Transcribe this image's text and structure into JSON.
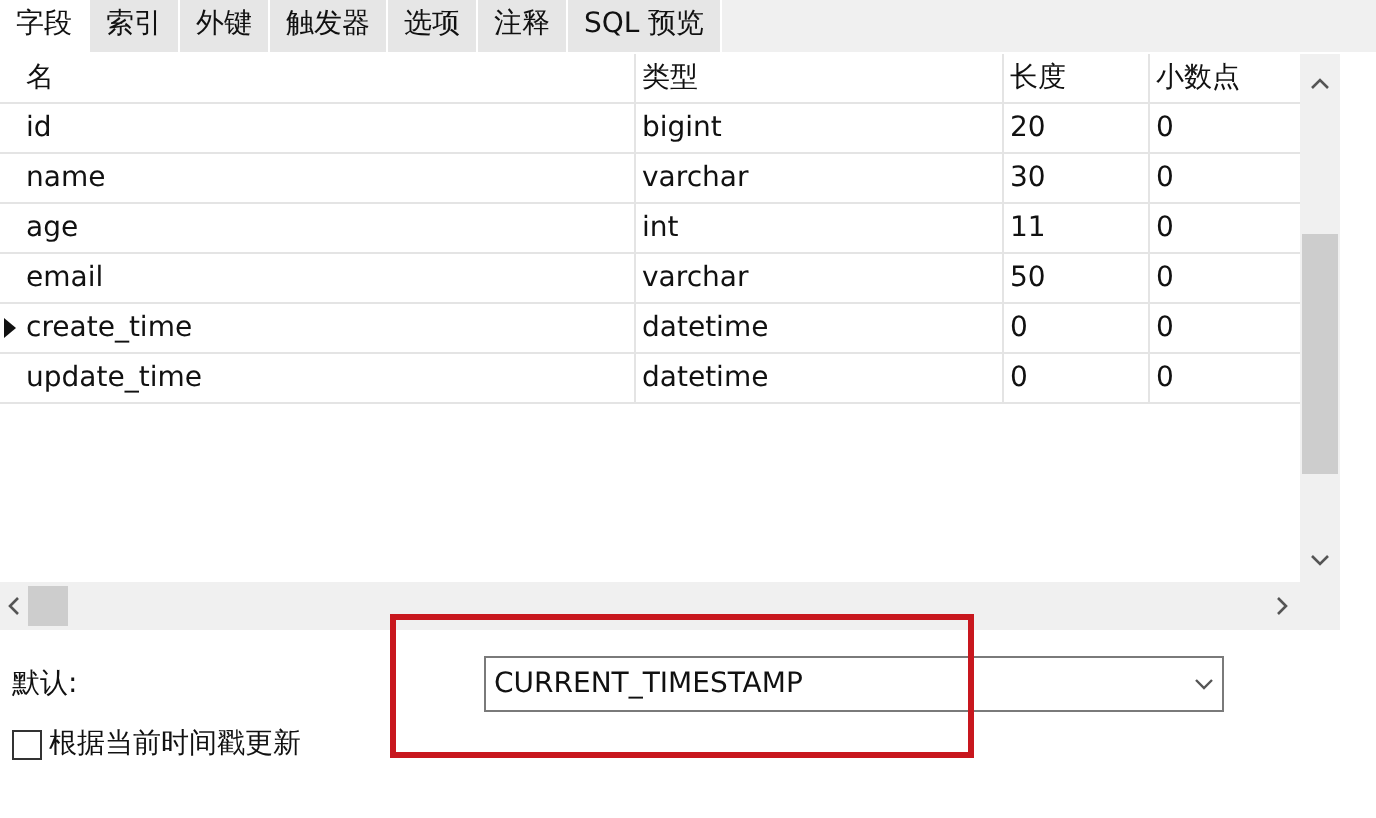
{
  "tabs": [
    {
      "label": "字段",
      "selected": true
    },
    {
      "label": "索引",
      "selected": false
    },
    {
      "label": "外键",
      "selected": false
    },
    {
      "label": "触发器",
      "selected": false
    },
    {
      "label": "选项",
      "selected": false
    },
    {
      "label": "注释",
      "selected": false
    },
    {
      "label": "SQL 预览",
      "selected": false
    }
  ],
  "table": {
    "columns": [
      "名",
      "类型",
      "长度",
      "小数点"
    ],
    "rows": [
      {
        "cells": [
          "id",
          "bigint",
          "20",
          "0"
        ],
        "current": false
      },
      {
        "cells": [
          "name",
          "varchar",
          "30",
          "0"
        ],
        "current": false
      },
      {
        "cells": [
          "age",
          "int",
          "11",
          "0"
        ],
        "current": false
      },
      {
        "cells": [
          "email",
          "varchar",
          "50",
          "0"
        ],
        "current": false
      },
      {
        "cells": [
          "create_time",
          "datetime",
          "0",
          "0"
        ],
        "current": true
      },
      {
        "cells": [
          "update_time",
          "datetime",
          "0",
          "0"
        ],
        "current": false
      }
    ]
  },
  "default_field": {
    "label": "默认:",
    "value": "CURRENT_TIMESTAMP",
    "highlighted": true
  },
  "update_checkbox": {
    "label": "根据当前时间戳更新",
    "checked": false
  }
}
